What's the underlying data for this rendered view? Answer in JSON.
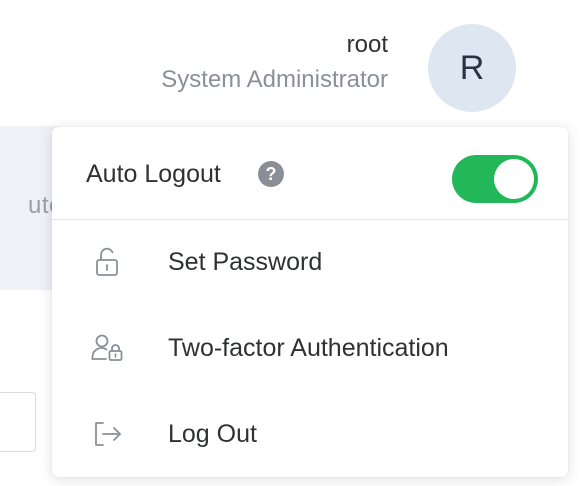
{
  "header": {
    "user_name": "root",
    "user_role": "System Administrator",
    "avatar_initial": "R"
  },
  "background": {
    "partial_text": "uto"
  },
  "dropdown": {
    "auto_logout_label": "Auto Logout",
    "help_icon": "?",
    "auto_logout_enabled": true,
    "items": [
      {
        "label": "Set Password",
        "icon": "unlock-icon"
      },
      {
        "label": "Two-factor Authentication",
        "icon": "user-lock-icon"
      },
      {
        "label": "Log Out",
        "icon": "logout-icon"
      }
    ]
  },
  "colors": {
    "toggle_on": "#22b85a",
    "avatar_bg": "#dde6f1",
    "icon_gray": "#8a8f97"
  }
}
